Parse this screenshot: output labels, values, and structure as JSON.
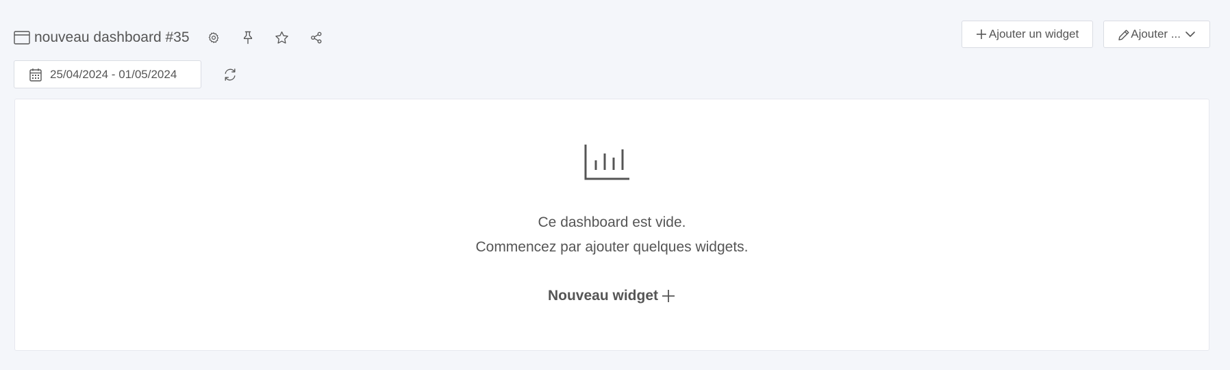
{
  "header": {
    "title": "nouveau dashboard #35",
    "title_icon": "window-icon",
    "actions": [
      {
        "name": "settings",
        "icon": "gear-icon"
      },
      {
        "name": "pin",
        "icon": "pin-icon"
      },
      {
        "name": "favorite",
        "icon": "star-icon"
      },
      {
        "name": "share",
        "icon": "share-icon"
      }
    ],
    "add_widget_label": "Ajouter un widget",
    "add_menu_label": "Ajouter ..."
  },
  "date_range": {
    "value": "25/04/2024 - 01/05/2024",
    "icon": "calendar-icon"
  },
  "refresh": {
    "icon": "refresh-icon"
  },
  "empty_state": {
    "icon": "bar-chart-icon",
    "line1": "Ce dashboard est vide.",
    "line2": "Commencez par ajouter quelques widgets.",
    "new_widget_label": "Nouveau widget"
  },
  "colors": {
    "background": "#f4f6fa",
    "panel": "#ffffff",
    "text": "#555555",
    "border": "#d9dce3"
  }
}
